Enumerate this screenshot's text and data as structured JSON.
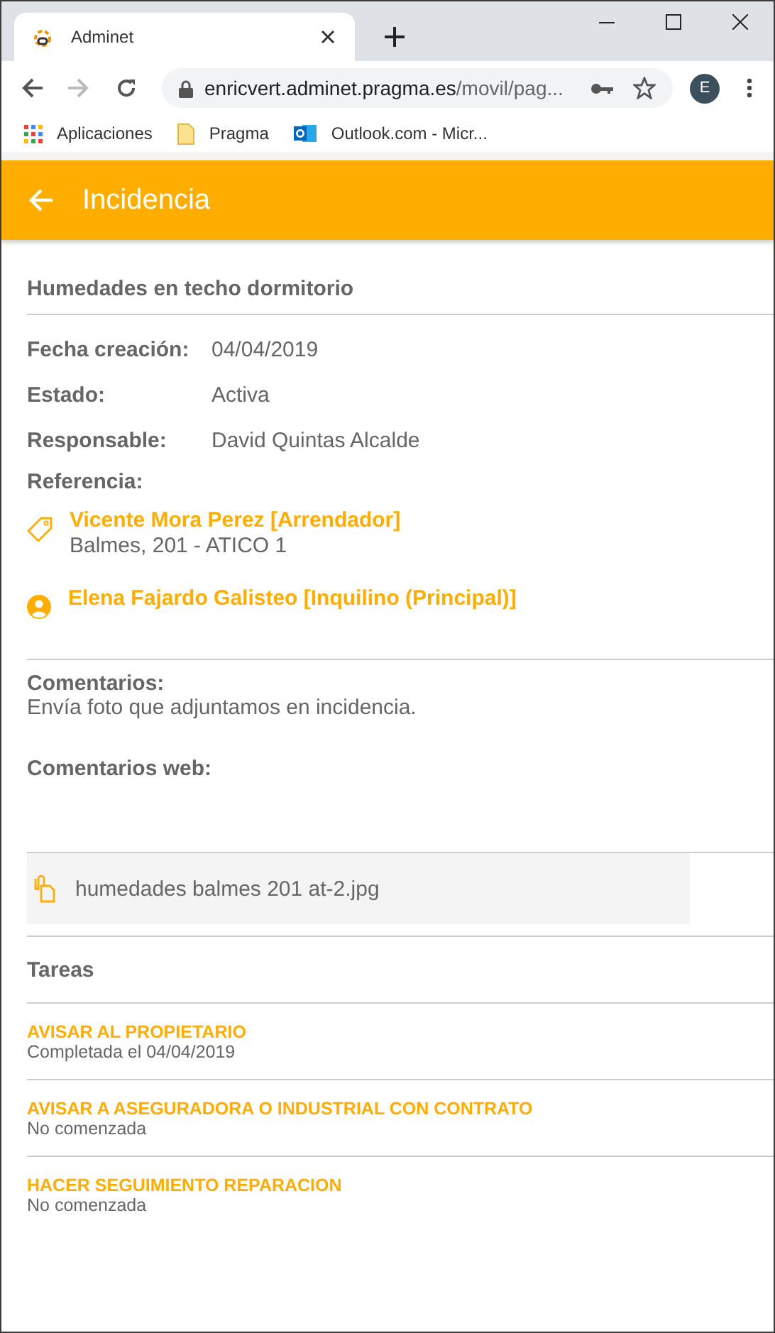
{
  "browser": {
    "tab": {
      "title": "Adminet"
    },
    "address": {
      "host": "enricvert.adminet.pragma.es",
      "path": "/movil/pag..."
    },
    "profile": "E",
    "bookmarks": [
      {
        "label": "Aplicaciones",
        "kind": "apps"
      },
      {
        "label": "Pragma",
        "kind": "folder"
      },
      {
        "label": "Outlook.com - Micr...",
        "kind": "outlook"
      }
    ]
  },
  "app_bar": {
    "title": "Incidencia"
  },
  "incident": {
    "title": "Humedades en techo dormitorio",
    "fields": [
      {
        "label": "Fecha creación:",
        "value": "04/04/2019"
      },
      {
        "label": "Estado:",
        "value": "Activa"
      },
      {
        "label": "Responsable:",
        "value": "David Quintas Alcalde"
      }
    ],
    "reference_label": "Referencia:",
    "references": [
      {
        "kind": "tag",
        "name": "Vicente Mora Perez [Arrendador]",
        "detail": "Balmes, 201 - ATICO 1"
      },
      {
        "kind": "person",
        "name": "Elena Fajardo Galisteo [Inquilino (Principal)]"
      }
    ],
    "comments_label": "Comentarios:",
    "comments": "Envía foto que adjuntamos en incidencia.",
    "web_comments_label": "Comentarios web:",
    "attachment": "humedades balmes 201 at-2.jpg"
  },
  "tasks": {
    "title": "Tareas",
    "items": [
      {
        "name": "AVISAR AL PROPIETARIO",
        "status": "Completada el 04/04/2019"
      },
      {
        "name": "AVISAR A ASEGURADORA O INDUSTRIAL CON CONTRATO",
        "status": "No comenzada"
      },
      {
        "name": "HACER SEGUIMIENTO REPARACION",
        "status": "No comenzada"
      }
    ]
  }
}
